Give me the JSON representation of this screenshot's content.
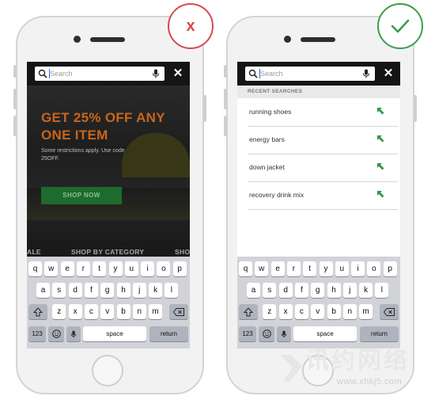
{
  "left": {
    "search_placeholder": "Search",
    "headline": "GET 25% OFF ANY ONE ITEM",
    "subtext": "Some restrictions apply. Use code 25OFF.",
    "cta": "SHOP NOW",
    "category_bar": {
      "prev": "ALE",
      "current": "SHOP BY CATEGORY",
      "next": "SHO"
    },
    "verdict_symbol": "x",
    "verdict_color": "#d9484c"
  },
  "right": {
    "search_placeholder": "Search",
    "recent_header": "RECENT SEARCHES",
    "recent": [
      "running shoes",
      "energy bars",
      "down jacket",
      "recovery drink mix"
    ],
    "verdict_icon": "checkmark-icon",
    "verdict_color": "#3a9e4c",
    "arrow_color": "#2f9a4a"
  },
  "keyboard": {
    "row1": [
      "q",
      "w",
      "e",
      "r",
      "t",
      "y",
      "u",
      "i",
      "o",
      "p"
    ],
    "row2": [
      "a",
      "s",
      "d",
      "f",
      "g",
      "h",
      "j",
      "k",
      "l"
    ],
    "row3": [
      "z",
      "x",
      "c",
      "v",
      "b",
      "n",
      "m"
    ],
    "numbers": "123",
    "space": "space",
    "return": "return",
    "shift_icon": "shift-icon",
    "delete_icon": "delete-icon",
    "emoji_icon": "emoji-icon",
    "mic_icon": "microphone-icon"
  },
  "watermark": {
    "text_cn": "讯约网络",
    "url": "www.xhkj5.com"
  }
}
